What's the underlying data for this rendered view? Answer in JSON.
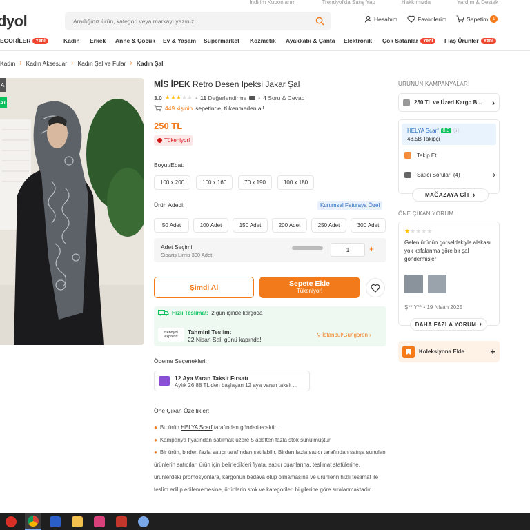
{
  "top_links": [
    "İndirim Kuponlarım",
    "Trendyol'da Satış Yap",
    "Hakkımızda",
    "Yardım & Destek"
  ],
  "logo_text": "dyol",
  "search": {
    "placeholder": "Aradığınız ürün, kategori veya markayı yazınız"
  },
  "header": {
    "account": "Hesabım",
    "favorites": "Favorilerim",
    "cart": "Sepetim",
    "cart_count": "1"
  },
  "categories": [
    {
      "label": "EGORİLER",
      "badge": "Yeni"
    },
    {
      "label": "Kadın"
    },
    {
      "label": "Erkek"
    },
    {
      "label": "Anne & Çocuk"
    },
    {
      "label": "Ev & Yaşam"
    },
    {
      "label": "Süpermarket"
    },
    {
      "label": "Kozmetik"
    },
    {
      "label": "Ayakkabı & Çanta"
    },
    {
      "label": "Elektronik"
    },
    {
      "label": "Çok Satanlar",
      "badge": "Yeni"
    },
    {
      "label": "Flaş Ürünler",
      "badge": "Yeni"
    }
  ],
  "breadcrumb": [
    "Kadın",
    "Kadın Aksesuar",
    "Kadın Şal ve Fular",
    "Kadın Şal"
  ],
  "photo_labels": {
    "a": "A",
    "b": "AT"
  },
  "product": {
    "brand": "MİS İPEK",
    "name": "Retro Desen Ipeksi Jakar Şal",
    "rating": "3.0",
    "stars_filled": 3,
    "reviews_count": "11",
    "reviews_text": "Değerlendirme",
    "qa_count": "4",
    "qa_text": "Soru & Cevap",
    "basket_count": "449 kişinin",
    "basket_text": "sepetinde, tükenmeden al!",
    "price": "250 TL",
    "stock_badge": "Tükeniyor!"
  },
  "size": {
    "label": "Boyut/Ebat:",
    "options": [
      "100 x 200",
      "100 x 160",
      "70 x 190",
      "100 x 180"
    ]
  },
  "quantity": {
    "label": "Ürün Adedi:",
    "corporate": "Kurumsal Faturaya Özel",
    "options": [
      "50 Adet",
      "100 Adet",
      "150 Adet",
      "200 Adet",
      "250 Adet",
      "300 Adet"
    ],
    "selection_label": "Adet Seçimi",
    "limit_text": "Sipariş Limiti 300 Adet",
    "value": "1",
    "plus": "+"
  },
  "buttons": {
    "buy_now": "Şimdi Al",
    "add_to_cart": "Sepete Ekle",
    "add_to_cart_sub": "Tükeniyor!"
  },
  "shipping": {
    "fast_label": "Hızlı Teslimat:",
    "fast_text": "2 gün içinde kargoda",
    "logo": "trendyol express",
    "est_label": "Tahmini Teslim:",
    "est_date": "22 Nisan Salı günü kapında!",
    "location": "İstanbul/Güngören"
  },
  "payment": {
    "label": "Ödeme Seçenekleri:",
    "title": "12 Aya Varan Taksit Fırsatı",
    "subtitle": "Aylık 26,88 TL'den başlayan 12 aya varan taksit ..."
  },
  "features": {
    "label": "Öne Çıkan Özellikler:",
    "items": [
      {
        "pre": "Bu ürün ",
        "link": "HELYA Scarf",
        "post": " tarafından gönderilecektir."
      },
      {
        "pre": "Kampanya fiyatından satılmak üzere 5 adetten fazla stok sunulmuştur."
      },
      {
        "pre": "Bir ürün, birden fazla satıcı tarafından satılabilir. Birden fazla satıcı tarafından satışa sunulan ürünlerin satıcıları ürün için belirledikleri fiyata, satıcı puanlarına, teslimat statülerine, ürünlerdeki promosyonlara, kargonun bedava olup olmamasına ve ürünlerin hızlı teslimat ile teslim edilip edilememesine, ürünlerin stok ve kategorileri bilgilerine göre sıralanmaktadır."
      }
    ]
  },
  "campaigns": {
    "title": "ÜRÜNÜN KAMPANYALARI",
    "item": "250 TL ve Üzeri Kargo B..."
  },
  "seller": {
    "name": "HELYA Scarf",
    "score": "8.3",
    "followers": "48,5B Takipçi",
    "follow": "Takip Et",
    "questions": "Satıcı Soruları (4)",
    "store_btn": "MAĞAZAYA GİT"
  },
  "review": {
    "title": "ÖNE ÇIKAN YORUM",
    "stars_filled": 1,
    "text": "Gelen ürünün gorseldekiyle alakası yok kafalanma göre bir şal göndermişler",
    "author": "Ş** Y** • 19 Nisan 2025",
    "more_btn": "DAHA FAZLA YORUM"
  },
  "collection": {
    "label": "Koleksiyona Ekle"
  },
  "colors": {
    "accent": "#f27a1a",
    "badge_red": "#f1452f",
    "green": "#0bc15c",
    "blue": "#2c6ec0"
  }
}
